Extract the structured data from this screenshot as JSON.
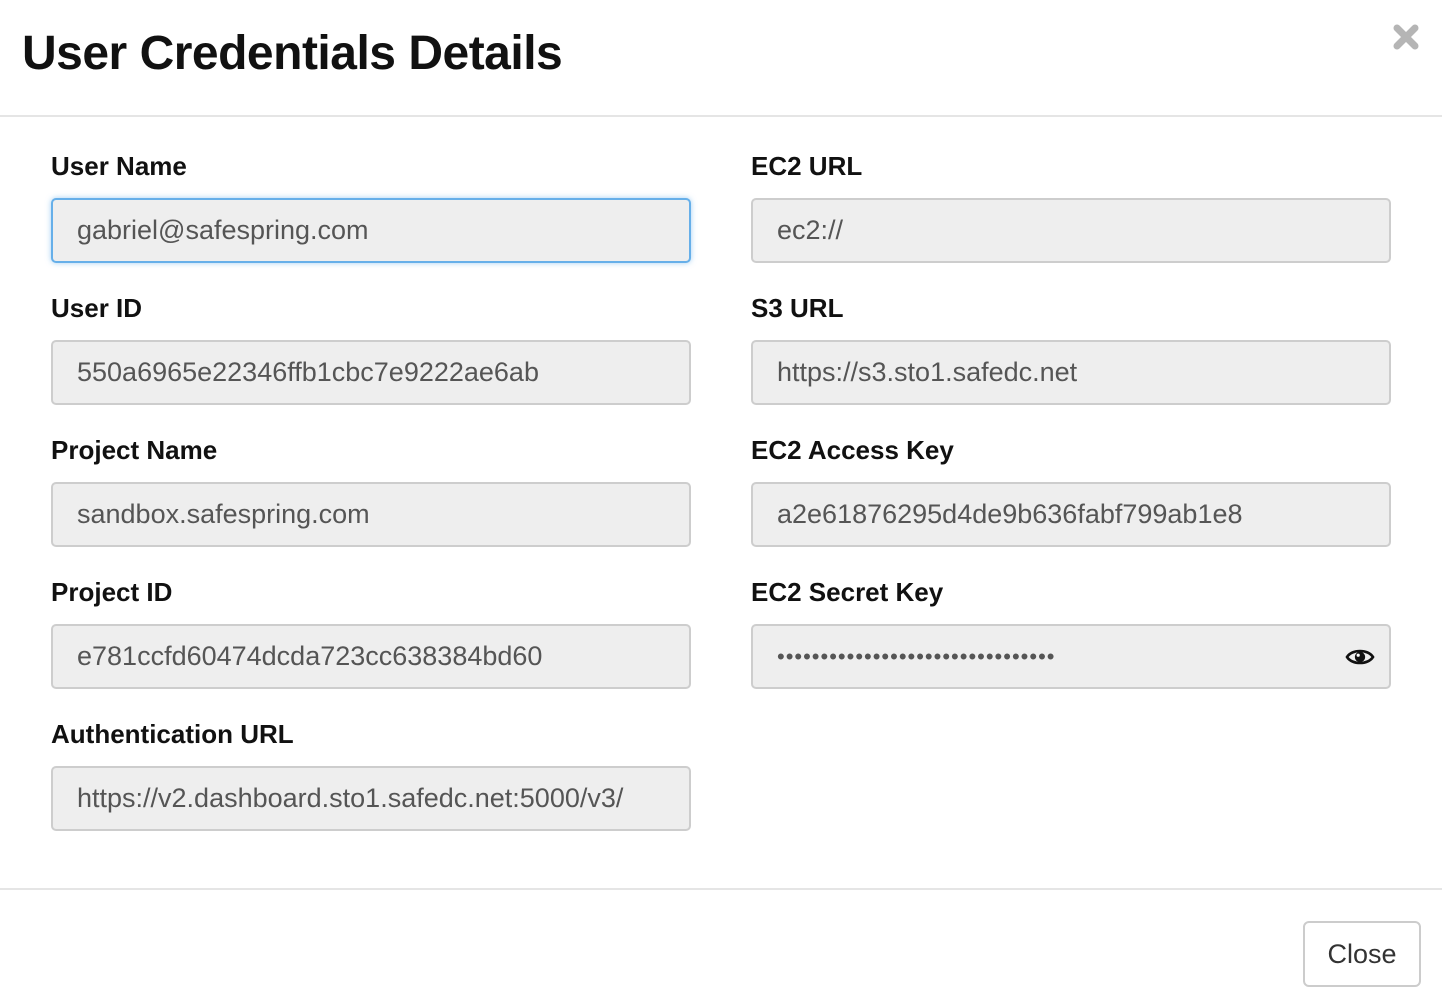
{
  "dialog": {
    "title": "User Credentials Details",
    "close_icon": "close-icon",
    "close_button_label": "Close"
  },
  "fields": {
    "user_name": {
      "label": "User Name",
      "value": "gabriel@safespring.com"
    },
    "user_id": {
      "label": "User ID",
      "value": "550a6965e22346ffb1cbc7e9222ae6ab"
    },
    "project_name": {
      "label": "Project Name",
      "value": "sandbox.safespring.com"
    },
    "project_id": {
      "label": "Project ID",
      "value": "e781ccfd60474dcda723cc638384bd60"
    },
    "auth_url": {
      "label": "Authentication URL",
      "value": "https://v2.dashboard.sto1.safedc.net:5000/v3/"
    },
    "ec2_url": {
      "label": "EC2 URL",
      "value": "ec2://"
    },
    "s3_url": {
      "label": "S3 URL",
      "value": "https://s3.sto1.safedc.net"
    },
    "ec2_access_key": {
      "label": "EC2 Access Key",
      "value": "a2e61876295d4de9b636fabf799ab1e8"
    },
    "ec2_secret_key": {
      "label": "EC2 Secret Key",
      "value": "••••••••••••••••••••••••••••••••",
      "toggle_icon": "eye-icon"
    }
  },
  "colors": {
    "focus_border": "#66afe9",
    "input_bg": "#eeeeee"
  }
}
